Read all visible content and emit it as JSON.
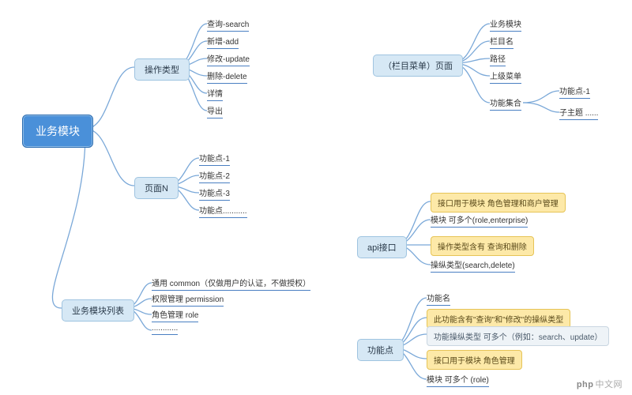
{
  "watermark": "php中文网",
  "left": {
    "root": "业务模块",
    "op": {
      "label": "操作类型",
      "items": [
        "查询-search",
        "新增-add",
        "修改-update",
        "删除-delete",
        "详情",
        "导出"
      ]
    },
    "pageN": {
      "label": "页面N",
      "items": [
        "功能点-1",
        "功能点-2",
        "功能点-3",
        "功能点..........."
      ]
    },
    "moduleList": {
      "label": "业务模块列表",
      "items": [
        "通用 common（仅做用户的认证，不做授权）",
        "权限管理 permission",
        "角色管理 role",
        "............"
      ]
    }
  },
  "right": {
    "page": {
      "label": "（栏目菜单）页面",
      "items": [
        "业务模块",
        "栏目名",
        "路径",
        "上级菜单"
      ],
      "funcSet": {
        "label": "功能集合",
        "children": [
          "功能点-1",
          "子主题 ......"
        ]
      }
    },
    "api": {
      "label": "api接口",
      "note_top": "接口用于模块 角色管理和商户管理",
      "items_top": "模块 可多个(role,enterprise)",
      "note_mid": "操作类型含有 查询和删除",
      "items_bot": "操纵类型(search,delete)"
    },
    "func": {
      "label": "功能点",
      "name": "功能名",
      "note_mid": "此功能含有\"查询\"和\"修改\"的操纵类型",
      "dim": "功能操纵类型 可多个（例如：search、update）",
      "note_bot": "接口用于模块 角色管理",
      "items_bot": "模块 可多个 (role)"
    }
  }
}
